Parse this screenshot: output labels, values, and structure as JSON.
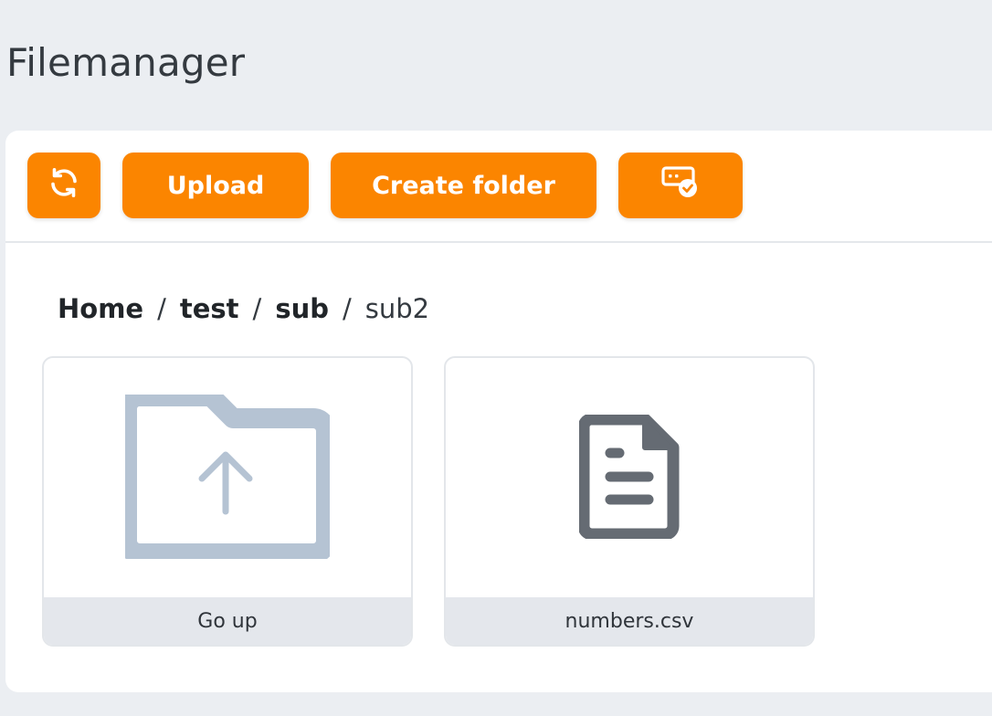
{
  "page": {
    "title": "Filemanager"
  },
  "toolbar": {
    "refresh_icon": "refresh-icon",
    "upload_label": "Upload",
    "create_folder_label": "Create folder",
    "select_icon": "select-check-icon",
    "accent_color": "#fb8500"
  },
  "breadcrumb": {
    "items": [
      {
        "label": "Home",
        "link": true
      },
      {
        "label": "test",
        "link": true
      },
      {
        "label": "sub",
        "link": true
      },
      {
        "label": "sub2",
        "link": false
      }
    ],
    "separator": "/"
  },
  "tiles": [
    {
      "label": "Go up",
      "icon": "folder-up-icon"
    },
    {
      "label": "numbers.csv",
      "icon": "file-text-icon"
    }
  ]
}
